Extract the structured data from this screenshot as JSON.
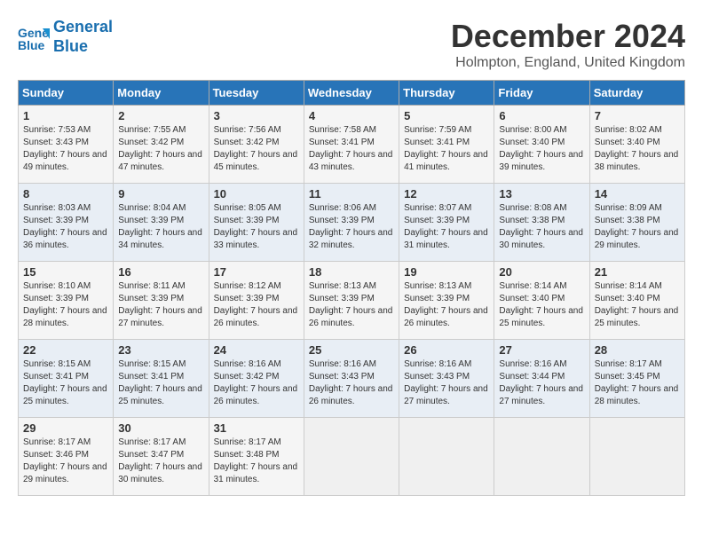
{
  "header": {
    "logo_line1": "General",
    "logo_line2": "Blue",
    "title": "December 2024",
    "location": "Holmpton, England, United Kingdom"
  },
  "days_of_week": [
    "Sunday",
    "Monday",
    "Tuesday",
    "Wednesday",
    "Thursday",
    "Friday",
    "Saturday"
  ],
  "weeks": [
    [
      {
        "day": "1",
        "sunrise": "Sunrise: 7:53 AM",
        "sunset": "Sunset: 3:43 PM",
        "daylight": "Daylight: 7 hours and 49 minutes."
      },
      {
        "day": "2",
        "sunrise": "Sunrise: 7:55 AM",
        "sunset": "Sunset: 3:42 PM",
        "daylight": "Daylight: 7 hours and 47 minutes."
      },
      {
        "day": "3",
        "sunrise": "Sunrise: 7:56 AM",
        "sunset": "Sunset: 3:42 PM",
        "daylight": "Daylight: 7 hours and 45 minutes."
      },
      {
        "day": "4",
        "sunrise": "Sunrise: 7:58 AM",
        "sunset": "Sunset: 3:41 PM",
        "daylight": "Daylight: 7 hours and 43 minutes."
      },
      {
        "day": "5",
        "sunrise": "Sunrise: 7:59 AM",
        "sunset": "Sunset: 3:41 PM",
        "daylight": "Daylight: 7 hours and 41 minutes."
      },
      {
        "day": "6",
        "sunrise": "Sunrise: 8:00 AM",
        "sunset": "Sunset: 3:40 PM",
        "daylight": "Daylight: 7 hours and 39 minutes."
      },
      {
        "day": "7",
        "sunrise": "Sunrise: 8:02 AM",
        "sunset": "Sunset: 3:40 PM",
        "daylight": "Daylight: 7 hours and 38 minutes."
      }
    ],
    [
      {
        "day": "8",
        "sunrise": "Sunrise: 8:03 AM",
        "sunset": "Sunset: 3:39 PM",
        "daylight": "Daylight: 7 hours and 36 minutes."
      },
      {
        "day": "9",
        "sunrise": "Sunrise: 8:04 AM",
        "sunset": "Sunset: 3:39 PM",
        "daylight": "Daylight: 7 hours and 34 minutes."
      },
      {
        "day": "10",
        "sunrise": "Sunrise: 8:05 AM",
        "sunset": "Sunset: 3:39 PM",
        "daylight": "Daylight: 7 hours and 33 minutes."
      },
      {
        "day": "11",
        "sunrise": "Sunrise: 8:06 AM",
        "sunset": "Sunset: 3:39 PM",
        "daylight": "Daylight: 7 hours and 32 minutes."
      },
      {
        "day": "12",
        "sunrise": "Sunrise: 8:07 AM",
        "sunset": "Sunset: 3:39 PM",
        "daylight": "Daylight: 7 hours and 31 minutes."
      },
      {
        "day": "13",
        "sunrise": "Sunrise: 8:08 AM",
        "sunset": "Sunset: 3:38 PM",
        "daylight": "Daylight: 7 hours and 30 minutes."
      },
      {
        "day": "14",
        "sunrise": "Sunrise: 8:09 AM",
        "sunset": "Sunset: 3:38 PM",
        "daylight": "Daylight: 7 hours and 29 minutes."
      }
    ],
    [
      {
        "day": "15",
        "sunrise": "Sunrise: 8:10 AM",
        "sunset": "Sunset: 3:39 PM",
        "daylight": "Daylight: 7 hours and 28 minutes."
      },
      {
        "day": "16",
        "sunrise": "Sunrise: 8:11 AM",
        "sunset": "Sunset: 3:39 PM",
        "daylight": "Daylight: 7 hours and 27 minutes."
      },
      {
        "day": "17",
        "sunrise": "Sunrise: 8:12 AM",
        "sunset": "Sunset: 3:39 PM",
        "daylight": "Daylight: 7 hours and 26 minutes."
      },
      {
        "day": "18",
        "sunrise": "Sunrise: 8:13 AM",
        "sunset": "Sunset: 3:39 PM",
        "daylight": "Daylight: 7 hours and 26 minutes."
      },
      {
        "day": "19",
        "sunrise": "Sunrise: 8:13 AM",
        "sunset": "Sunset: 3:39 PM",
        "daylight": "Daylight: 7 hours and 26 minutes."
      },
      {
        "day": "20",
        "sunrise": "Sunrise: 8:14 AM",
        "sunset": "Sunset: 3:40 PM",
        "daylight": "Daylight: 7 hours and 25 minutes."
      },
      {
        "day": "21",
        "sunrise": "Sunrise: 8:14 AM",
        "sunset": "Sunset: 3:40 PM",
        "daylight": "Daylight: 7 hours and 25 minutes."
      }
    ],
    [
      {
        "day": "22",
        "sunrise": "Sunrise: 8:15 AM",
        "sunset": "Sunset: 3:41 PM",
        "daylight": "Daylight: 7 hours and 25 minutes."
      },
      {
        "day": "23",
        "sunrise": "Sunrise: 8:15 AM",
        "sunset": "Sunset: 3:41 PM",
        "daylight": "Daylight: 7 hours and 25 minutes."
      },
      {
        "day": "24",
        "sunrise": "Sunrise: 8:16 AM",
        "sunset": "Sunset: 3:42 PM",
        "daylight": "Daylight: 7 hours and 26 minutes."
      },
      {
        "day": "25",
        "sunrise": "Sunrise: 8:16 AM",
        "sunset": "Sunset: 3:43 PM",
        "daylight": "Daylight: 7 hours and 26 minutes."
      },
      {
        "day": "26",
        "sunrise": "Sunrise: 8:16 AM",
        "sunset": "Sunset: 3:43 PM",
        "daylight": "Daylight: 7 hours and 27 minutes."
      },
      {
        "day": "27",
        "sunrise": "Sunrise: 8:16 AM",
        "sunset": "Sunset: 3:44 PM",
        "daylight": "Daylight: 7 hours and 27 minutes."
      },
      {
        "day": "28",
        "sunrise": "Sunrise: 8:17 AM",
        "sunset": "Sunset: 3:45 PM",
        "daylight": "Daylight: 7 hours and 28 minutes."
      }
    ],
    [
      {
        "day": "29",
        "sunrise": "Sunrise: 8:17 AM",
        "sunset": "Sunset: 3:46 PM",
        "daylight": "Daylight: 7 hours and 29 minutes."
      },
      {
        "day": "30",
        "sunrise": "Sunrise: 8:17 AM",
        "sunset": "Sunset: 3:47 PM",
        "daylight": "Daylight: 7 hours and 30 minutes."
      },
      {
        "day": "31",
        "sunrise": "Sunrise: 8:17 AM",
        "sunset": "Sunset: 3:48 PM",
        "daylight": "Daylight: 7 hours and 31 minutes."
      },
      null,
      null,
      null,
      null
    ]
  ]
}
